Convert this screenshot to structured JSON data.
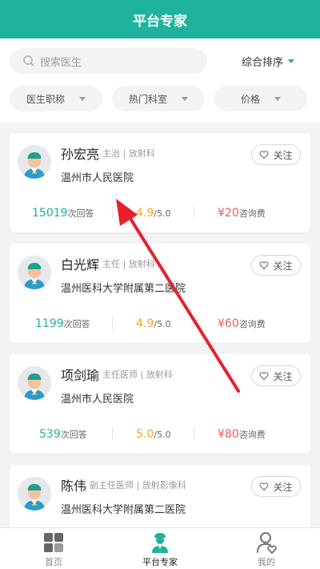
{
  "header": {
    "title": "平台专家"
  },
  "search": {
    "placeholder": "搜索医生"
  },
  "sort": {
    "label": "综合排序"
  },
  "filters": [
    {
      "label": "医生职称"
    },
    {
      "label": "热门科室"
    },
    {
      "label": "价格"
    }
  ],
  "doctors": [
    {
      "name": "孙宏亮",
      "title": "主治 | 放射科",
      "hospital": "温州市人民医院",
      "answers": "15019",
      "answers_unit": "次回答",
      "rating": "4.9",
      "rating_unit": "/5.0",
      "price": "¥20",
      "price_unit": "咨询费",
      "follow_label": "关注"
    },
    {
      "name": "白光辉",
      "title": "主任 | 放射科",
      "hospital": "温州医科大学附属第二医院",
      "answers": "1199",
      "answers_unit": "次回答",
      "rating": "4.9",
      "rating_unit": "/5.0",
      "price": "¥60",
      "price_unit": "咨询费",
      "follow_label": "关注"
    },
    {
      "name": "项剑瑜",
      "title": "主任医师 | 放射科",
      "hospital": "温州市人民医院",
      "answers": "539",
      "answers_unit": "次回答",
      "rating": "5.0",
      "rating_unit": "/5.0",
      "price": "¥80",
      "price_unit": "咨询费",
      "follow_label": "关注"
    },
    {
      "name": "陈伟",
      "title": "副主任医师 | 放射影像科",
      "hospital": "温州医科大学附属第二医院",
      "follow_label": "关注"
    }
  ],
  "tabbar": {
    "items": [
      {
        "label": "首页",
        "icon": "home-grid-icon"
      },
      {
        "label": "平台专家",
        "icon": "doctor-icon",
        "active": true
      },
      {
        "label": "我的",
        "icon": "profile-heart-icon"
      }
    ]
  },
  "colors": {
    "brand": "#1fb39e",
    "rating": "#f5a623",
    "price": "#f25b5b",
    "annotation_arrow": "#e8202a"
  }
}
